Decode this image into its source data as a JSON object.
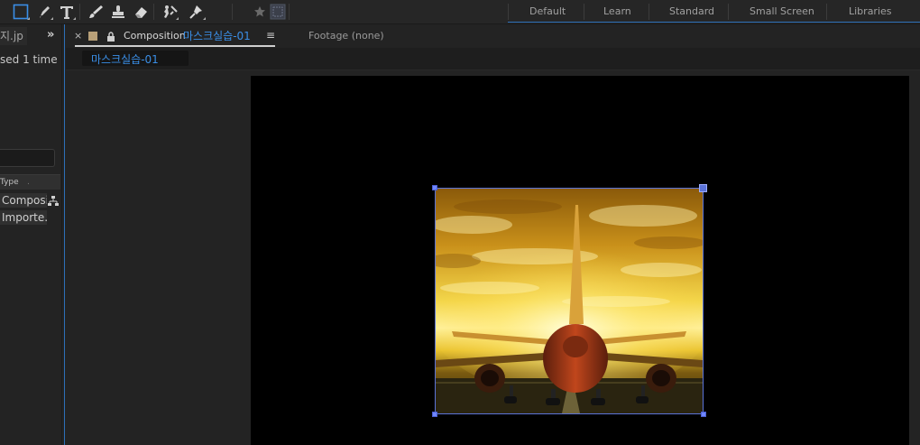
{
  "toolbar": {
    "tools": [
      "rectangle-tool",
      "pen-tool",
      "type-tool",
      "brush-tool",
      "clone-stamp-tool",
      "eraser-tool",
      "roto-brush-tool",
      "puppet-pin-tool"
    ],
    "snapping_icon": "star-icon"
  },
  "workspaces": [
    "Default",
    "Learn",
    "Standard",
    "Small Screen",
    "Libraries"
  ],
  "project": {
    "tab_label": "지.jp",
    "more_glyph": "»",
    "usage_text": "sed 1 time",
    "column_header": "Type",
    "rows": [
      "Composi",
      "Importe.."
    ]
  },
  "composition": {
    "close_glyph": "×",
    "tab_label": "Composition",
    "tab_name": "마스크실습-01",
    "menu_glyph": "≡",
    "footage_tab": "Footage  (none)",
    "breadcrumb": "마스크실습-01"
  },
  "colors": {
    "accent_blue": "#3a8ee6",
    "selection_blue": "#5b73d8",
    "swatch": "#b8a078"
  }
}
